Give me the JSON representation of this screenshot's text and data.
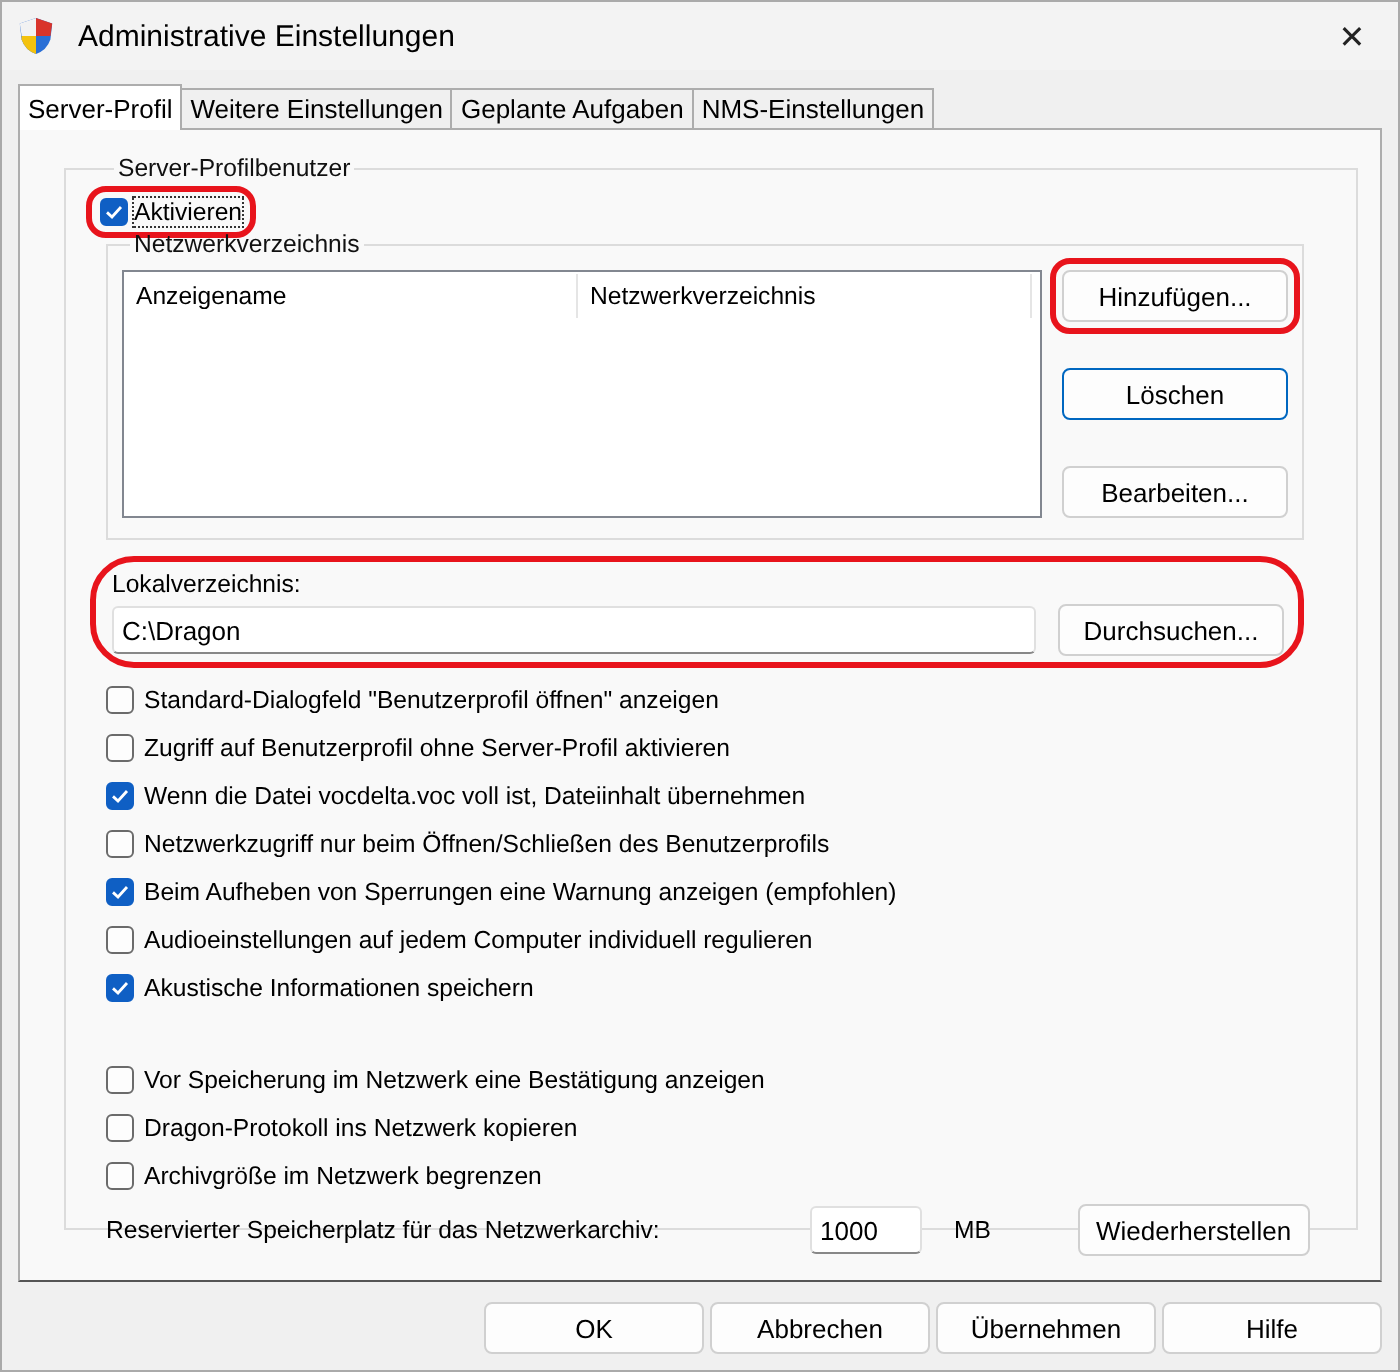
{
  "window": {
    "title": "Administrative Einstellungen",
    "close": "✕"
  },
  "tabs": [
    {
      "label": "Server-Profil",
      "selected": true
    },
    {
      "label": "Weitere Einstellungen",
      "selected": false
    },
    {
      "label": "Geplante Aufgaben",
      "selected": false
    },
    {
      "label": "NMS-Einstellungen",
      "selected": false
    }
  ],
  "group": {
    "title": "Server-Profilbenutzer",
    "enable": {
      "label": "Aktivieren",
      "checked": true,
      "highlighted": true
    },
    "network": {
      "title": "Netzwerkverzeichnis",
      "columns": [
        "Anzeigename",
        "Netzwerkverzeichnis"
      ],
      "buttons": [
        {
          "label": "Hinzufügen...",
          "highlighted": true,
          "focused": false
        },
        {
          "label": "Löschen",
          "highlighted": false,
          "focused": true
        },
        {
          "label": "Bearbeiten...",
          "highlighted": false,
          "focused": false
        }
      ]
    },
    "local": {
      "label": "Lokalverzeichnis:",
      "value": "C:\\Dragon",
      "button": "Durchsuchen...",
      "highlighted": true
    },
    "options": [
      {
        "label": "Standard-Dialogfeld \"Benutzerprofil öffnen\" anzeigen",
        "checked": false
      },
      {
        "label": "Zugriff auf Benutzerprofil ohne Server-Profil aktivieren",
        "checked": false
      },
      {
        "label": "Wenn die Datei vocdelta.voc voll ist, Dateiinhalt übernehmen",
        "checked": true
      },
      {
        "label": "Netzwerkzugriff nur beim Öffnen/Schließen des Benutzerprofils",
        "checked": false
      },
      {
        "label": "Beim Aufheben von Sperrungen eine Warnung anzeigen (empfohlen)",
        "checked": true
      },
      {
        "label": "Audioeinstellungen auf jedem Computer individuell regulieren",
        "checked": false
      },
      {
        "label": "Akustische Informationen speichern",
        "checked": true
      }
    ],
    "network_options": [
      {
        "label": "Vor Speicherung im Netzwerk eine Bestätigung anzeigen",
        "checked": false
      },
      {
        "label": "Dragon-Protokoll ins Netzwerk kopieren",
        "checked": false
      },
      {
        "label": "Archivgröße im Netzwerk begrenzen",
        "checked": false
      }
    ],
    "reserve": {
      "label": "Reservierter Speicherplatz für das Netzwerkarchiv:",
      "value": "1000",
      "unit": "MB",
      "button": "Wiederherstellen"
    }
  },
  "buttons": [
    "OK",
    "Abbrechen",
    "Übernehmen",
    "Hilfe"
  ]
}
